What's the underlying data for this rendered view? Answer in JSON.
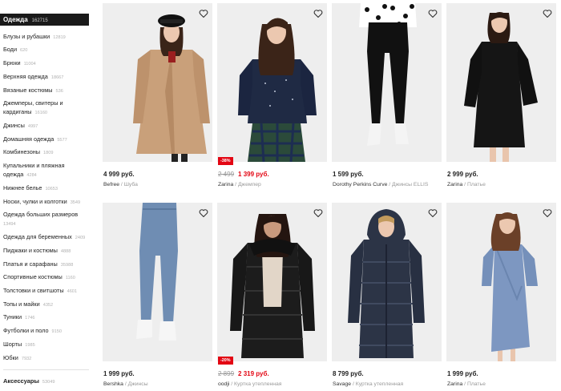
{
  "sidebar": {
    "header": {
      "label": "Одежда",
      "count": "162715"
    },
    "items": [
      {
        "label": "Блузы и рубашки",
        "count": "12819"
      },
      {
        "label": "Боди",
        "count": "620"
      },
      {
        "label": "Брюки",
        "count": "11004"
      },
      {
        "label": "Верхняя одежда",
        "count": "18667"
      },
      {
        "label": "Вязаные костюмы",
        "count": "536"
      },
      {
        "label": "Джемперы, свитеры и кардиганы",
        "count": "16160"
      },
      {
        "label": "Джинсы",
        "count": "4997"
      },
      {
        "label": "Домашняя одежда",
        "count": "5577"
      },
      {
        "label": "Комбинезоны",
        "count": "1809"
      },
      {
        "label": "Купальники и пляжная одежда",
        "count": "4284"
      },
      {
        "label": "Нижнее белье",
        "count": "10653"
      },
      {
        "label": "Носки, чулки и колготки",
        "count": "3549"
      },
      {
        "label": "Одежда больших размеров",
        "count": "13494"
      },
      {
        "label": "Одежда для беременных",
        "count": "2409"
      },
      {
        "label": "Пиджаки и костюмы",
        "count": "4888"
      },
      {
        "label": "Платья и сарафаны",
        "count": "35988"
      },
      {
        "label": "Спортивные костюмы",
        "count": "1160"
      },
      {
        "label": "Толстовки и свитшоты",
        "count": "4601"
      },
      {
        "label": "Топы и майки",
        "count": "4352"
      },
      {
        "label": "Туники",
        "count": "1746"
      },
      {
        "label": "Футболки и поло",
        "count": "9150"
      },
      {
        "label": "Шорты",
        "count": "1985"
      },
      {
        "label": "Юбки",
        "count": "7932"
      }
    ],
    "bottom": {
      "label": "Аксессуары",
      "count": "53049"
    }
  },
  "products": [
    {
      "price": "4 999 руб.",
      "old_price": "",
      "new_price": "",
      "discount": "",
      "brand": "Befree",
      "category": "Шуба",
      "image": "teddy-coat",
      "accent": "#c49a72"
    },
    {
      "price": "",
      "old_price": "2 499",
      "new_price": "1 399 руб.",
      "discount": "-38%",
      "brand": "Zarina",
      "category": "Джемпер",
      "image": "navy-sweater",
      "accent": "#1f2a44"
    },
    {
      "price": "1 599 руб.",
      "old_price": "",
      "new_price": "",
      "discount": "",
      "brand": "Dorothy Perkins Curve",
      "category": "Джинсы ELLIS",
      "image": "black-jeans",
      "accent": "#111111"
    },
    {
      "price": "2 999 руб.",
      "old_price": "",
      "new_price": "",
      "discount": "",
      "brand": "Zarina",
      "category": "Платье",
      "image": "black-dress",
      "accent": "#151515"
    },
    {
      "price": "1 999 руб.",
      "old_price": "",
      "new_price": "",
      "discount": "",
      "brand": "Bershka",
      "category": "Джинсы",
      "image": "blue-jeans",
      "accent": "#6f8db3"
    },
    {
      "price": "",
      "old_price": "2 899",
      "new_price": "2 319 руб.",
      "discount": "-20%",
      "brand": "oodji",
      "category": "Куртка утепленная",
      "image": "black-puffer",
      "accent": "#1c1c1c"
    },
    {
      "price": "8 799 руб.",
      "old_price": "",
      "new_price": "",
      "discount": "",
      "brand": "Savage",
      "category": "Куртка утепленная",
      "image": "navy-puffer",
      "accent": "#2c3446"
    },
    {
      "price": "1 999 руб.",
      "old_price": "",
      "new_price": "",
      "discount": "",
      "brand": "Zarina",
      "category": "Платье",
      "image": "blue-dress",
      "accent": "#7d97c1"
    }
  ]
}
